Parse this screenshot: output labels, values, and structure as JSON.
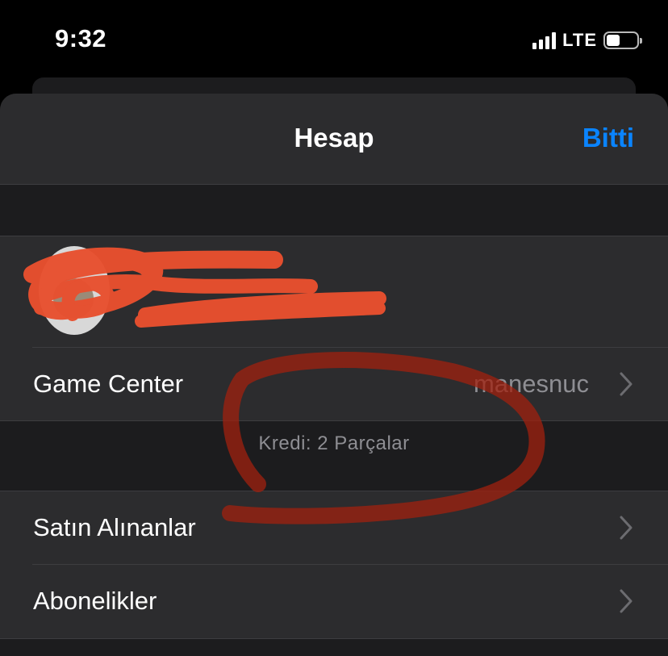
{
  "status_bar": {
    "time": "9:32",
    "network": "LTE",
    "battery_level": 0.45
  },
  "nav": {
    "title": "Hesap",
    "done_label": "Bitti",
    "accent_color": "#0a84ff"
  },
  "profile": {
    "avatar_icon": "avatar-icon",
    "redacted": true
  },
  "rows": {
    "game_center": {
      "label": "Game Center",
      "value": "manesnuc"
    },
    "credit_text": "Kredi: 2 Parçalar",
    "purchases": {
      "label": "Satın Alınanlar"
    },
    "subscriptions": {
      "label": "Abonelikler"
    }
  },
  "annotation_color": "#e8502f"
}
